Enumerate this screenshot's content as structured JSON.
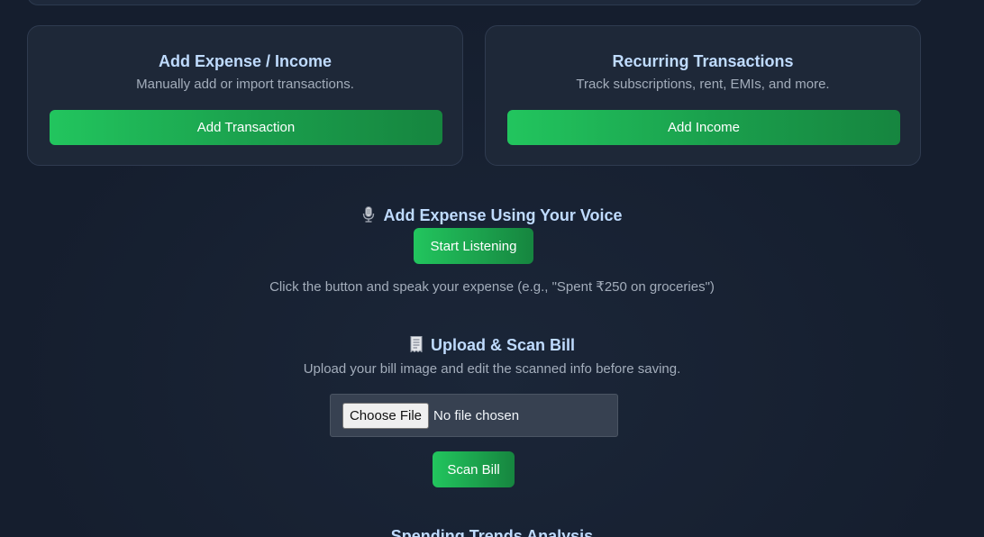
{
  "cards": [
    {
      "title": "Add Expense / Income",
      "subtitle": "Manually add or import transactions.",
      "button_label": "Add Transaction"
    },
    {
      "title": "Recurring Transactions",
      "subtitle": "Track subscriptions, rent, EMIs, and more.",
      "button_label": "Add Income"
    }
  ],
  "voice": {
    "icon": "microphone-icon",
    "title": "Add Expense Using Your Voice",
    "button_label": "Start Listening",
    "helper": "Click the button and speak your expense (e.g., \"Spent ₹250 on groceries\")"
  },
  "scan": {
    "icon": "receipt-icon",
    "title": "Upload & Scan Bill",
    "subtitle": "Upload your bill image and edit the scanned info before saving.",
    "file_button_label": "Choose File",
    "file_status": "No file chosen",
    "button_label": "Scan Bill"
  },
  "next_section_title": "Spending Trends Analysis",
  "colors": {
    "background": "#162032",
    "card": "#1e2838",
    "accent_green": "#22c55e",
    "title_blue": "#bfdbfe"
  }
}
